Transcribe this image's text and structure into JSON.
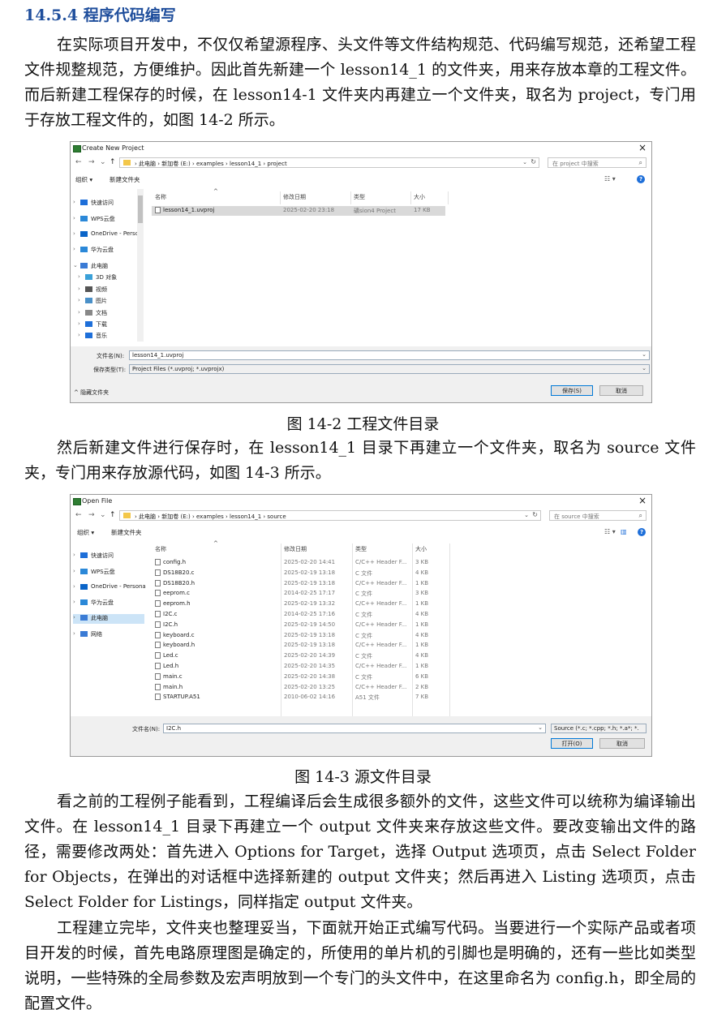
{
  "heading": "14.5.4 程序代码编写",
  "paragraphs": [
    "在实际项目开发中，不仅仅希望源程序、头文件等文件结构规范、代码编写规范，还希望工程文件规整规范，方便维护。因此首先新建一个 lesson14_1 的文件夹，用来存放本章的工程文件。而后新建工程保存的时候，在 lesson14-1 文件夹内再建立一个文件夹，取名为 project，专门用于存放工程文件的，如图 14-2 所示。",
    "然后新建文件进行保存时，在 lesson14_1 目录下再建立一个文件夹，取名为 source 文件夹，专门用来存放源代码，如图 14-3 所示。",
    "看之前的工程例子能看到，工程编译后会生成很多额外的文件，这些文件可以统称为编译输出文件。在 lesson14_1 目录下再建立一个 output 文件夹来存放这些文件。要改变输出文件的路径，需要修改两处：首先进入 Options for Target，选择 Output 选项页，点击 Select Folder for Objects，在弹出的对话框中选择新建的 output 文件夹；然后再进入 Listing 选项页，点击 Select Folder for Listings，同样指定 output 文件夹。",
    "工程建立完毕，文件夹也整理妥当，下面就开始正式编写代码。当要进行一个实际产品或者项目开发的时候，首先电路原理图是确定的，所使用的单片机的引脚也是明确的，还有一些比如类型说明，一些特殊的全局参数及宏声明放到一个专门的头文件中，在这里命名为 config.h，即全局的配置文件。"
  ],
  "figure1": {
    "caption": "图 14-2  工程文件目录",
    "title": "Create New Project",
    "close": "×",
    "nav_back": "←",
    "nav_fwd": "→",
    "nav_down": "⌄",
    "nav_up": "↑",
    "breadcrumb": "›  此电脑  ›  新加卷 (E:)  ›  examples  ›  lesson14_1  ›  project",
    "search_placeholder": "在 project 中搜索",
    "cmd_organize": "组织 ▾",
    "cmd_newfolder": "新建文件夹",
    "view_icons": "☷ ▾",
    "help": "?",
    "columns": [
      "名称",
      "修改日期",
      "类型",
      "大小"
    ],
    "sort_arrow": "^",
    "nav_items": [
      {
        "label": "快速访问",
        "icon": "star-icon",
        "color": "#1e6fd9",
        "level": 0
      },
      {
        "label": "WPS云盘",
        "icon": "cloud-icon",
        "color": "#2b88d8",
        "level": 0
      },
      {
        "label": "OneDrive - Perso",
        "icon": "cloud-icon",
        "color": "#0a64c8",
        "level": 0
      },
      {
        "label": "华为云盘",
        "icon": "cloud-icon",
        "color": "#2b88d8",
        "level": 0
      },
      {
        "label": "此电脑",
        "icon": "computer-icon",
        "color": "#3a7bd5",
        "level": 0
      },
      {
        "label": "3D 对象",
        "icon": "cube-icon",
        "color": "#3aa0d8",
        "level": 1
      },
      {
        "label": "视频",
        "icon": "video-icon",
        "color": "#555555",
        "level": 1
      },
      {
        "label": "图片",
        "icon": "picture-icon",
        "color": "#4a90c8",
        "level": 1
      },
      {
        "label": "文档",
        "icon": "document-icon",
        "color": "#888888",
        "level": 1
      },
      {
        "label": "下载",
        "icon": "download-icon",
        "color": "#1e6fd9",
        "level": 1
      },
      {
        "label": "音乐",
        "icon": "music-icon",
        "color": "#1e6fd9",
        "level": 1
      }
    ],
    "files": [
      {
        "name": "lesson14_1.uvproj",
        "date": "2025-02-20 23:18",
        "type": "礦sion4 Project",
        "size": "17 KB"
      }
    ],
    "filename_label": "文件名(N):",
    "filename_value": "lesson14_1.uvproj",
    "filetype_label": "保存类型(T):",
    "filetype_value": "Project Files (*.uvproj; *.uvprojx)",
    "hide_folders": "^ 隐藏文件夹",
    "save_button": "保存(S)",
    "cancel_button": "取消"
  },
  "figure2": {
    "caption": "图 14-3  源文件目录",
    "title": "Open File",
    "close": "×",
    "nav_back": "←",
    "nav_fwd": "→",
    "nav_down": "⌄",
    "nav_up": "↑",
    "breadcrumb": "›  此电脑  ›  新加卷 (E:)  ›  examples  ›  lesson14_1  ›  source",
    "search_placeholder": "在 source 中搜索",
    "cmd_organize": "组织 ▾",
    "cmd_newfolder": "新建文件夹",
    "view_icons": "☷ ▾",
    "preview_pane": "▥",
    "help": "?",
    "columns": [
      "名称",
      "修改日期",
      "类型",
      "大小"
    ],
    "sort_arrow": "^",
    "nav_items": [
      {
        "label": "快速访问",
        "icon": "star-icon",
        "color": "#1e6fd9"
      },
      {
        "label": "WPS云盘",
        "icon": "cloud-icon",
        "color": "#2b88d8"
      },
      {
        "label": "OneDrive - Persona",
        "icon": "cloud-icon",
        "color": "#0a64c8"
      },
      {
        "label": "华为云盘",
        "icon": "cloud-icon",
        "color": "#2b88d8"
      },
      {
        "label": "此电脑",
        "icon": "computer-icon",
        "color": "#3a7bd5"
      },
      {
        "label": "网络",
        "icon": "network-icon",
        "color": "#3a7bd5"
      }
    ],
    "files": [
      {
        "name": "config.h",
        "date": "2025-02-20 14:41",
        "type": "C/C++ Header F...",
        "size": "3 KB"
      },
      {
        "name": "DS18B20.c",
        "date": "2025-02-19 13:18",
        "type": "C 文件",
        "size": "4 KB"
      },
      {
        "name": "DS18B20.h",
        "date": "2025-02-19 13:18",
        "type": "C/C++ Header F...",
        "size": "1 KB"
      },
      {
        "name": "eeprom.c",
        "date": "2014-02-25 17:17",
        "type": "C 文件",
        "size": "3 KB"
      },
      {
        "name": "eeprom.h",
        "date": "2025-02-19 13:32",
        "type": "C/C++ Header F...",
        "size": "1 KB"
      },
      {
        "name": "I2C.c",
        "date": "2014-02-25 17:16",
        "type": "C 文件",
        "size": "4 KB"
      },
      {
        "name": "I2C.h",
        "date": "2025-02-19 14:50",
        "type": "C/C++ Header F...",
        "size": "1 KB"
      },
      {
        "name": "keyboard.c",
        "date": "2025-02-19 13:18",
        "type": "C 文件",
        "size": "4 KB"
      },
      {
        "name": "keyboard.h",
        "date": "2025-02-19 13:18",
        "type": "C/C++ Header F...",
        "size": "1 KB"
      },
      {
        "name": "Led.c",
        "date": "2025-02-20 14:39",
        "type": "C 文件",
        "size": "4 KB"
      },
      {
        "name": "Led.h",
        "date": "2025-02-20 14:35",
        "type": "C/C++ Header F...",
        "size": "1 KB"
      },
      {
        "name": "main.c",
        "date": "2025-02-20 14:38",
        "type": "C 文件",
        "size": "6 KB"
      },
      {
        "name": "main.h",
        "date": "2025-02-20 13:25",
        "type": "C/C++ Header F...",
        "size": "2 KB"
      },
      {
        "name": "STARTUP.A51",
        "date": "2010-06-02 14:16",
        "type": "A51 文件",
        "size": "7 KB"
      }
    ],
    "filename_label": "文件名(N):",
    "filename_value": "I2C.h",
    "filetype_value": "Source (*.c; *.cpp; *.h; *.a*; *.",
    "open_button": "打开(O)",
    "cancel_button": "取消"
  }
}
